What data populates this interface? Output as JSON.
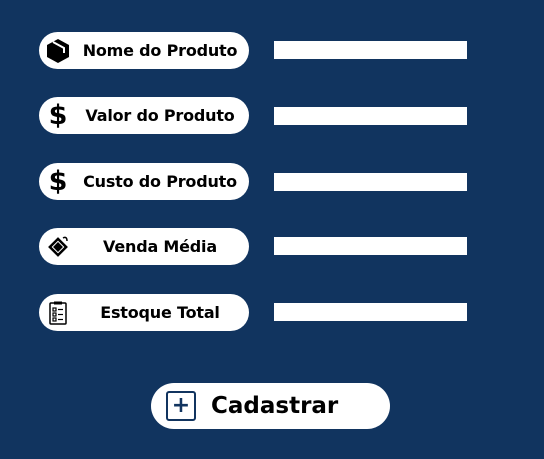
{
  "fields": [
    {
      "label": "Nome do Produto",
      "icon": "box-icon",
      "value": ""
    },
    {
      "label": "Valor do Produto",
      "icon": "dollar-icon",
      "value": ""
    },
    {
      "label": "Custo do Produto",
      "icon": "dollar-icon",
      "value": ""
    },
    {
      "label": "Venda Média",
      "icon": "price-tag-icon",
      "value": ""
    },
    {
      "label": "Estoque Total",
      "icon": "clipboard-icon",
      "value": ""
    }
  ],
  "icons": {
    "dollar": "$",
    "plus": "+"
  },
  "submit": {
    "label": "Cadastrar"
  },
  "colors": {
    "background": "#11345f",
    "pill": "#ffffff"
  }
}
